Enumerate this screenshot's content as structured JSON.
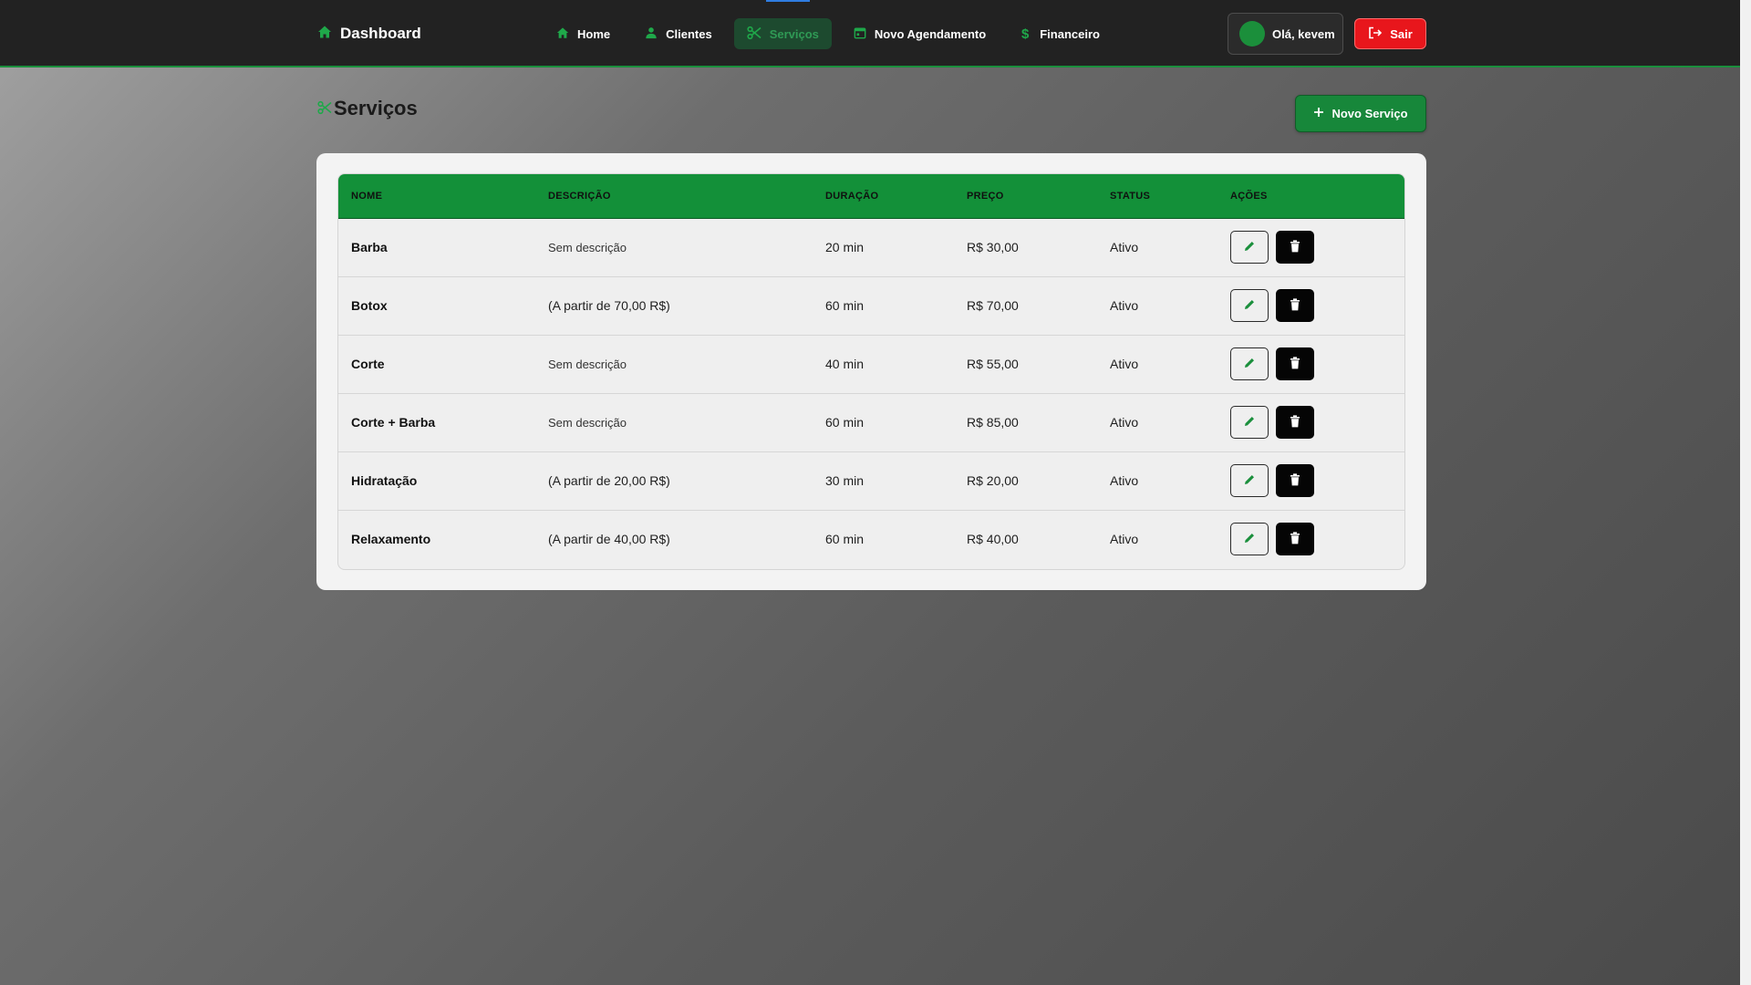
{
  "navbar": {
    "brand_label": "Dashboard",
    "links": [
      {
        "label": "Home",
        "icon": "home-icon",
        "active": false
      },
      {
        "label": "Clientes",
        "icon": "person-icon",
        "active": false
      },
      {
        "label": "Serviços",
        "icon": "scissors-icon",
        "active": true
      },
      {
        "label": "Novo Agendamento",
        "icon": "calendar-icon",
        "active": false
      },
      {
        "label": "Financeiro",
        "icon": "dollar-icon",
        "active": false
      }
    ],
    "user_greeting": "Olá, kevem",
    "logout_label": "Sair"
  },
  "page": {
    "title": "Serviços",
    "new_button_label": "Novo Serviço"
  },
  "table": {
    "columns": [
      "NOME",
      "DESCRIÇÃO",
      "DURAÇÃO",
      "PREÇO",
      "STATUS",
      "AÇÕES"
    ],
    "rows": [
      {
        "name": "Barba",
        "description": "Sem descrição",
        "duration": "20 min",
        "price": "R$ 30,00",
        "status": "Ativo"
      },
      {
        "name": "Botox",
        "description": "(A partir de 70,00 R$)",
        "duration": "60 min",
        "price": "R$ 70,00",
        "status": "Ativo"
      },
      {
        "name": "Corte",
        "description": "Sem descrição",
        "duration": "40 min",
        "price": "R$ 55,00",
        "status": "Ativo"
      },
      {
        "name": "Corte + Barba",
        "description": "Sem descrição",
        "duration": "60 min",
        "price": "R$ 85,00",
        "status": "Ativo"
      },
      {
        "name": "Hidratação",
        "description": "(A partir de 20,00 R$)",
        "duration": "30 min",
        "price": "R$ 20,00",
        "status": "Ativo"
      },
      {
        "name": "Relaxamento",
        "description": "(A partir de 40,00 R$)",
        "duration": "60 min",
        "price": "R$ 40,00",
        "status": "Ativo"
      }
    ]
  },
  "colors": {
    "accent_green": "#139039",
    "navbar_bg": "#222222",
    "logout_red": "#e8161c"
  }
}
